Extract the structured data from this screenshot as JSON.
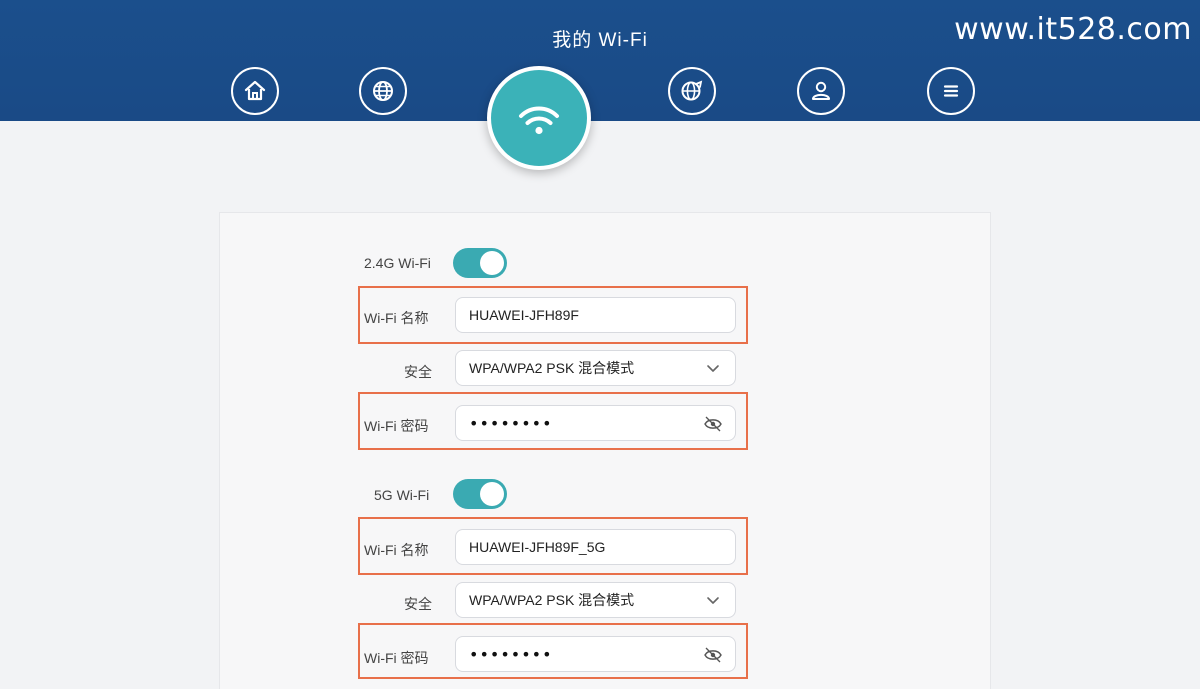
{
  "header": {
    "title": "我的 Wi-Fi",
    "watermark": "www.it528.com"
  },
  "nav": [
    {
      "name": "home-icon"
    },
    {
      "name": "globe-icon"
    },
    {
      "name": "wifi-icon",
      "active": true
    },
    {
      "name": "globe-settings-icon"
    },
    {
      "name": "user-icon"
    },
    {
      "name": "menu-icon"
    }
  ],
  "wifi24": {
    "toggle_label": "2.4G Wi-Fi",
    "enabled": true,
    "name_label": "Wi-Fi 名称",
    "name_value": "HUAWEI-JFH89F",
    "security_label": "安全",
    "security_value": "WPA/WPA2 PSK 混合模式",
    "password_label": "Wi-Fi 密码",
    "password_mask": "••••••••"
  },
  "wifi5": {
    "toggle_label": "5G Wi-Fi",
    "enabled": true,
    "name_label": "Wi-Fi 名称",
    "name_value": "HUAWEI-JFH89F_5G",
    "security_label": "安全",
    "security_value": "WPA/WPA2 PSK 混合模式",
    "password_label": "Wi-Fi 密码",
    "password_mask": "••••••••"
  },
  "colors": {
    "header": "#1b4f8c",
    "accent": "#3aaab2",
    "highlight": "#e8704a"
  }
}
